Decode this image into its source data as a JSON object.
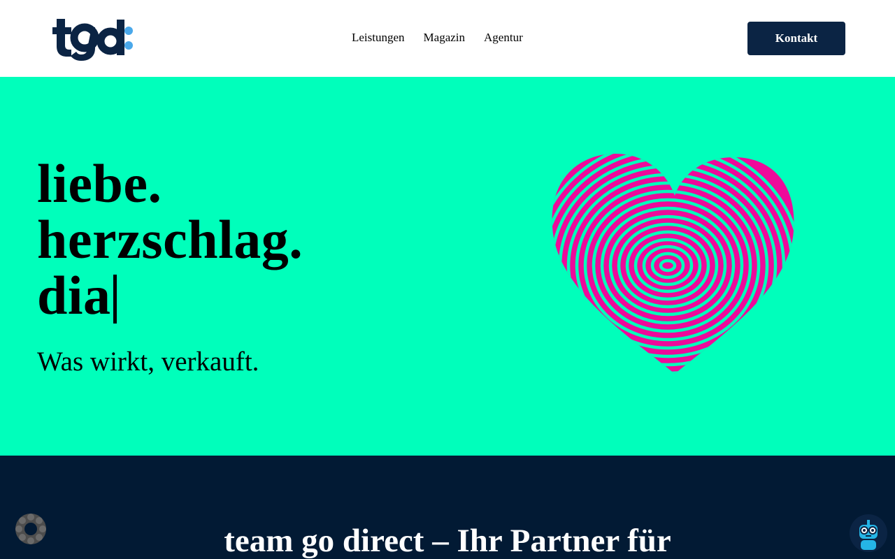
{
  "header": {
    "logo_text": "tgd:",
    "nav": [
      "Leistungen",
      "Magazin",
      "Agentur"
    ],
    "contact_label": "Kontakt"
  },
  "hero": {
    "lines": [
      "liebe.",
      "herzschlag.",
      "dia"
    ],
    "tagline": "Was wirkt, verkauft.",
    "image": "fingerprint-heart",
    "colors": {
      "background": "#00ffbb",
      "heart": "#ee0a9a"
    }
  },
  "section": {
    "heading": "team go direct – Ihr Partner für"
  },
  "widgets": {
    "cookie": "cookie-settings-icon",
    "chatbot": "chatbot-robot-icon"
  },
  "colors": {
    "brand_dark": "#0b2444",
    "footer_dark": "#021a34",
    "logo_accent": "#4aa8ea"
  }
}
